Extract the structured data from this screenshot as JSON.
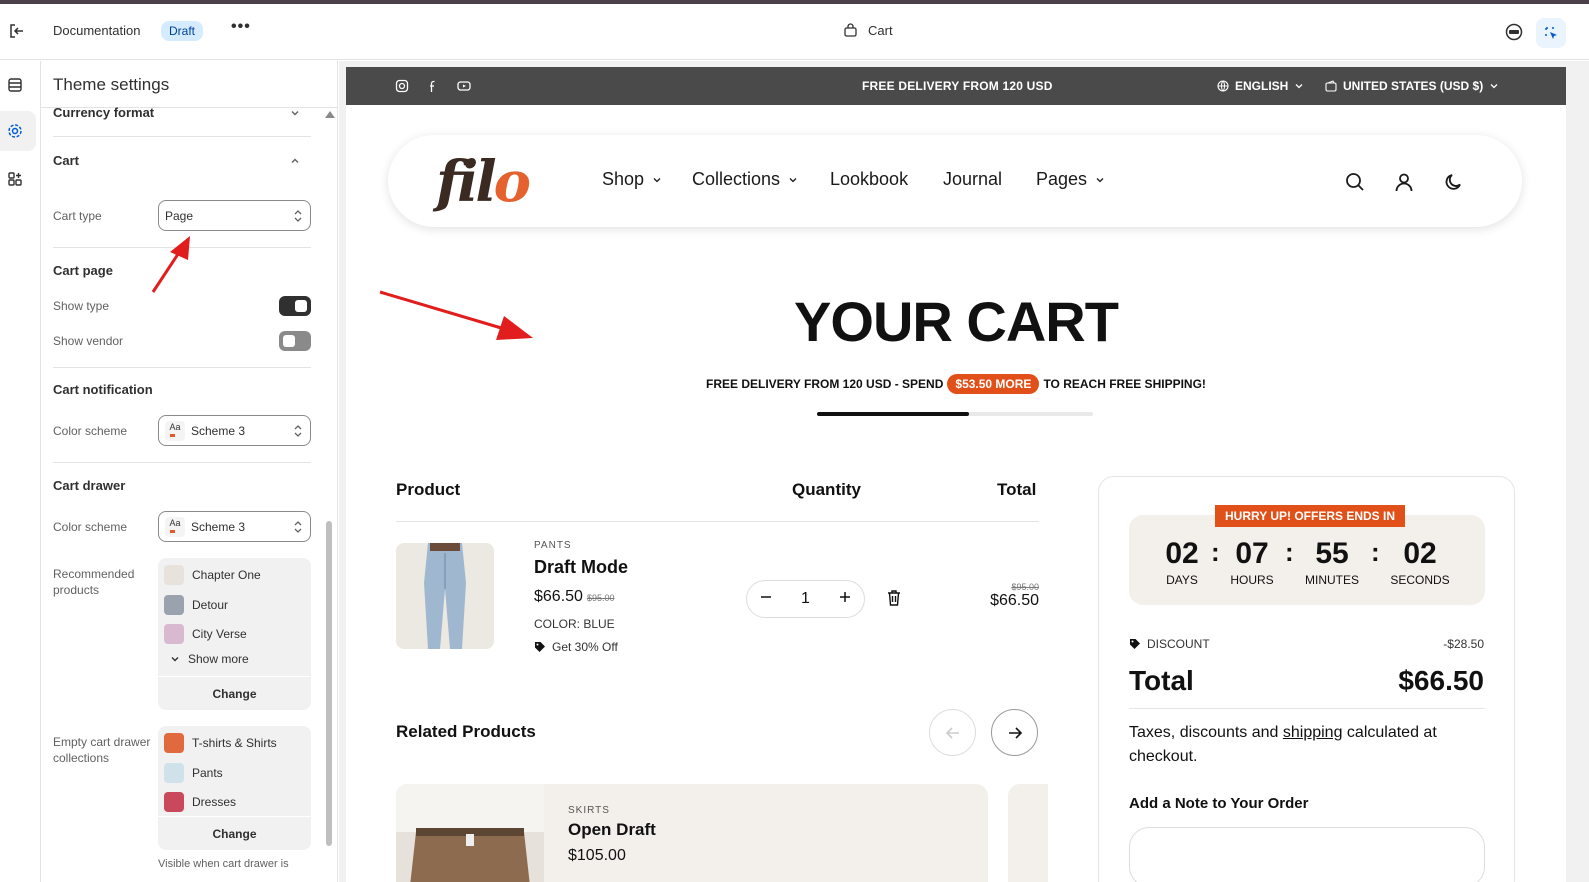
{
  "topbar": {
    "title": "Documentation",
    "badge": "Draft",
    "more": "•••",
    "template": "Cart"
  },
  "panel": {
    "title": "Theme settings",
    "currency_format": "Currency format",
    "cart_section": "Cart",
    "cart_type_label": "Cart type",
    "cart_type_value": "Page",
    "cart_page": "Cart page",
    "show_type": "Show type",
    "show_type_on": true,
    "show_vendor": "Show vendor",
    "show_vendor_on": false,
    "cart_notification": "Cart notification",
    "color_scheme_label": "Color scheme",
    "scheme_value": "Scheme 3",
    "scheme_swatch": "Aa",
    "cart_drawer": "Cart drawer",
    "color_scheme_label2": "Color scheme",
    "scheme_value2": "Scheme 3",
    "recommended_label": "Recommended products",
    "recommended": [
      "Chapter One",
      "Detour",
      "City Verse"
    ],
    "show_more": "Show more",
    "change": "Change",
    "empty_label": "Empty cart drawer collections",
    "empty_collections": [
      "T-shirts & Shirts",
      "Pants",
      "Dresses"
    ],
    "change2": "Change",
    "visible_note": "Visible when cart drawer is"
  },
  "store": {
    "announcement": "FREE DELIVERY FROM 120 USD",
    "language": "ENGLISH",
    "country": "UNITED STATES (USD $)",
    "logo_f": "fil",
    "logo_o": "o",
    "nav": [
      "Shop",
      "Collections",
      "Lookbook",
      "Journal",
      "Pages"
    ],
    "heading": "YOUR CART",
    "free_prefix": "FREE DELIVERY FROM 120 USD - SPEND",
    "free_amount": "$53.50 MORE",
    "free_suffix": "TO REACH FREE SHIPPING!",
    "progress": 0.55,
    "col_product": "Product",
    "col_quantity": "Quantity",
    "col_total": "Total",
    "item": {
      "vendor": "PANTS",
      "name": "Draft Mode",
      "price": "$66.50",
      "compare": "$95.00",
      "color": "COLOR: BLUE",
      "offer": "Get 30% Off",
      "quantity": "1",
      "line_compare": "$95.00",
      "line_total": "$66.50"
    },
    "related": "Related Products",
    "related_item": {
      "vendor": "SKIRTS",
      "name": "Open Draft",
      "price": "$105.00"
    },
    "summary": {
      "hurry": "HURRY UP! OFFERS ENDS IN",
      "days": "02",
      "hours": "07",
      "minutes": "55",
      "seconds": "02",
      "days_l": "DAYS",
      "hours_l": "HOURS",
      "minutes_l": "MINUTES",
      "seconds_l": "SECONDS",
      "discount": "DISCOUNT",
      "discount_value": "-$28.50",
      "total": "Total",
      "total_value": "$66.50",
      "tax_a": "Taxes, discounts and ",
      "tax_link": "shipping",
      "tax_b": " calculated at checkout.",
      "note": "Add a Note to Your Order"
    }
  },
  "colors": {
    "accent": "#e2501a",
    "logo_dark": "#3a2a22",
    "logo_orange": "#e5622f",
    "draft_badge": "#d5ebff"
  }
}
